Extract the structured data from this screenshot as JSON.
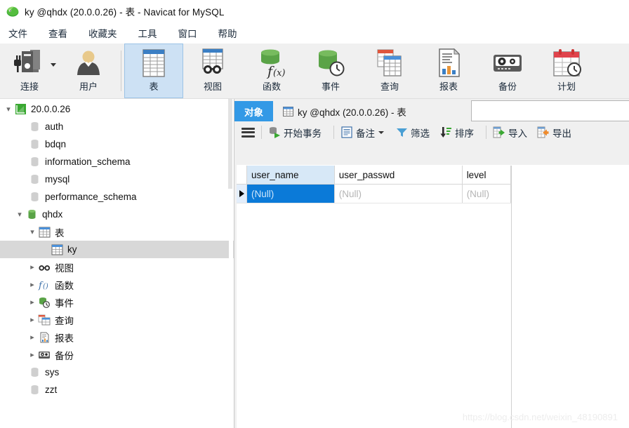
{
  "window": {
    "title": "ky @qhdx (20.0.0.26) - 表 - Navicat for MySQL",
    "logo_icon": "navicat-logo-icon"
  },
  "menubar": {
    "items": [
      {
        "label": "文件",
        "name": "menu-file"
      },
      {
        "label": "查看",
        "name": "menu-view"
      },
      {
        "label": "收藏夹",
        "name": "menu-favorites"
      },
      {
        "label": "工具",
        "name": "menu-tools"
      },
      {
        "label": "窗口",
        "name": "menu-window"
      },
      {
        "label": "帮助",
        "name": "menu-help"
      }
    ]
  },
  "ribbon": {
    "buttons": [
      {
        "label": "连接",
        "icon": "connection-icon",
        "active": false,
        "has_caret": true
      },
      {
        "label": "用户",
        "icon": "user-icon",
        "active": false,
        "has_caret": false
      },
      {
        "label": "表",
        "icon": "table-icon",
        "active": true,
        "has_caret": false
      },
      {
        "label": "视图",
        "icon": "view-icon",
        "active": false,
        "has_caret": false
      },
      {
        "label": "函数",
        "icon": "function-icon",
        "active": false,
        "has_caret": false
      },
      {
        "label": "事件",
        "icon": "event-icon",
        "active": false,
        "has_caret": false
      },
      {
        "label": "查询",
        "icon": "query-icon",
        "active": false,
        "has_caret": false
      },
      {
        "label": "报表",
        "icon": "report-icon",
        "active": false,
        "has_caret": false
      },
      {
        "label": "备份",
        "icon": "backup-icon",
        "active": false,
        "has_caret": false
      },
      {
        "label": "计划",
        "icon": "schedule-icon",
        "active": false,
        "has_caret": false
      }
    ]
  },
  "sidebar": {
    "nodes": [
      {
        "label": "20.0.0.26",
        "icon": "connection-node-icon",
        "indent": 0,
        "twisty": "expanded",
        "selected": false
      },
      {
        "label": "auth",
        "icon": "database-icon",
        "indent": 1,
        "twisty": "none",
        "selected": false
      },
      {
        "label": "bdqn",
        "icon": "database-icon",
        "indent": 1,
        "twisty": "none",
        "selected": false
      },
      {
        "label": "information_schema",
        "icon": "database-icon",
        "indent": 1,
        "twisty": "none",
        "selected": false
      },
      {
        "label": "mysql",
        "icon": "database-icon",
        "indent": 1,
        "twisty": "none",
        "selected": false
      },
      {
        "label": "performance_schema",
        "icon": "database-icon",
        "indent": 1,
        "twisty": "none",
        "selected": false
      },
      {
        "label": "qhdx",
        "icon": "database-open-icon",
        "indent": 1,
        "twisty": "expanded",
        "selected": false
      },
      {
        "label": "表",
        "icon": "table-folder-icon",
        "indent": 2,
        "twisty": "expanded",
        "selected": false
      },
      {
        "label": "ky",
        "icon": "table-icon",
        "indent": 3,
        "twisty": "none",
        "selected": true
      },
      {
        "label": "视图",
        "icon": "view-folder-icon",
        "indent": 2,
        "twisty": "collapsed",
        "selected": false
      },
      {
        "label": "函数",
        "icon": "function-folder-icon",
        "indent": 2,
        "twisty": "collapsed",
        "selected": false
      },
      {
        "label": "事件",
        "icon": "event-folder-icon",
        "indent": 2,
        "twisty": "collapsed",
        "selected": false
      },
      {
        "label": "查询",
        "icon": "query-folder-icon",
        "indent": 2,
        "twisty": "collapsed",
        "selected": false
      },
      {
        "label": "报表",
        "icon": "report-folder-icon",
        "indent": 2,
        "twisty": "collapsed",
        "selected": false
      },
      {
        "label": "备份",
        "icon": "backup-folder-icon",
        "indent": 2,
        "twisty": "collapsed",
        "selected": false
      },
      {
        "label": "sys",
        "icon": "database-icon",
        "indent": 1,
        "twisty": "none",
        "selected": false
      },
      {
        "label": "zzt",
        "icon": "database-icon",
        "indent": 1,
        "twisty": "none",
        "selected": false
      }
    ]
  },
  "tabs": [
    {
      "label": "对象",
      "icon": null,
      "active": true
    },
    {
      "label": "ky @qhdx (20.0.0.26) - 表",
      "icon": "table-icon",
      "active": false
    }
  ],
  "grid_toolbar": {
    "menu_icon": "hamburger-menu-icon",
    "items": [
      {
        "label": "开始事务",
        "icon": "begin-transaction-icon",
        "caret": false
      },
      {
        "label": "备注",
        "icon": "note-icon",
        "caret": true
      },
      {
        "label": "筛选",
        "icon": "filter-icon",
        "caret": false
      },
      {
        "label": "排序",
        "icon": "sort-icon",
        "caret": false
      },
      {
        "label": "导入",
        "icon": "import-icon",
        "caret": false
      },
      {
        "label": "导出",
        "icon": "export-icon",
        "caret": false
      }
    ]
  },
  "grid": {
    "columns": [
      {
        "label": "user_name",
        "selected": true
      },
      {
        "label": "user_passwd",
        "selected": false
      },
      {
        "label": "level",
        "selected": false
      }
    ],
    "rows": [
      {
        "current": true,
        "cells": [
          {
            "value": "(Null)",
            "selected": true
          },
          {
            "value": "(Null)",
            "selected": false
          },
          {
            "value": "(Null)",
            "selected": false
          }
        ]
      }
    ]
  },
  "watermark": {
    "text": "https://blog.csdn.net/weixin_48190891"
  },
  "colors": {
    "accent_tab": "#3399e6",
    "cell_selected": "#0b7ad8",
    "ribbon_active": "#cde1f4",
    "chrome": "#f0f0f0"
  }
}
